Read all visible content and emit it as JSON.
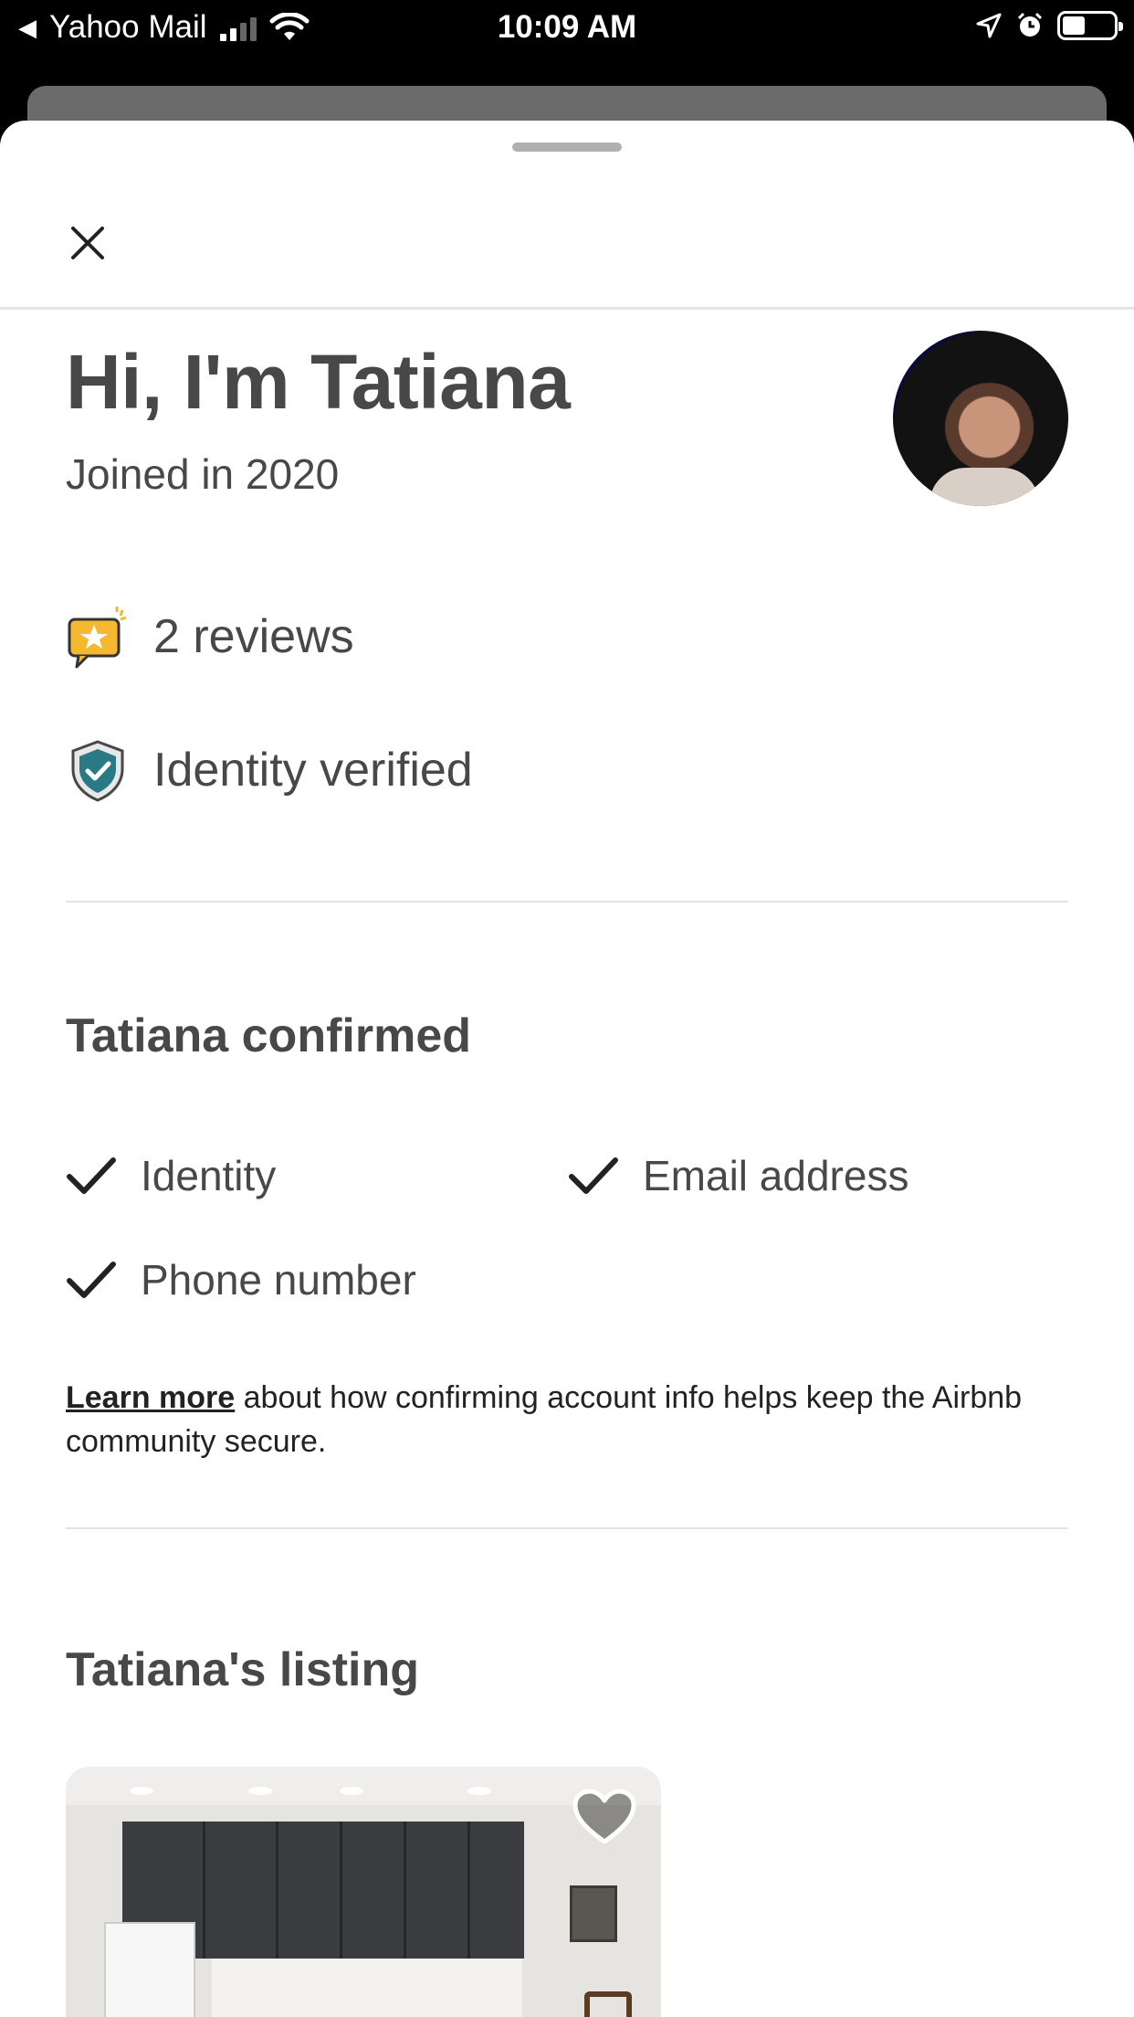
{
  "status_bar": {
    "back_app": "Yahoo Mail",
    "time": "10:09 AM"
  },
  "profile": {
    "title": "Hi, I'm Tatiana",
    "joined": "Joined in 2020",
    "reviews": "2 reviews",
    "identity": "Identity verified"
  },
  "confirmed": {
    "title": "Tatiana confirmed",
    "items": [
      "Identity",
      "Email address",
      "Phone number"
    ],
    "learn_more": "Learn more",
    "info_text": " about how confirming account info helps keep the Airbnb community secure."
  },
  "listing": {
    "title": "Tatiana's listing"
  },
  "icons": {
    "close": "close-icon",
    "reviews": "review-star-icon",
    "verified": "shield-check-icon",
    "check": "checkmark-icon",
    "favorite": "heart-icon"
  },
  "colors": {
    "text": "#484848",
    "shield": "#2a7a85",
    "star_badge": "#f5b82e"
  }
}
